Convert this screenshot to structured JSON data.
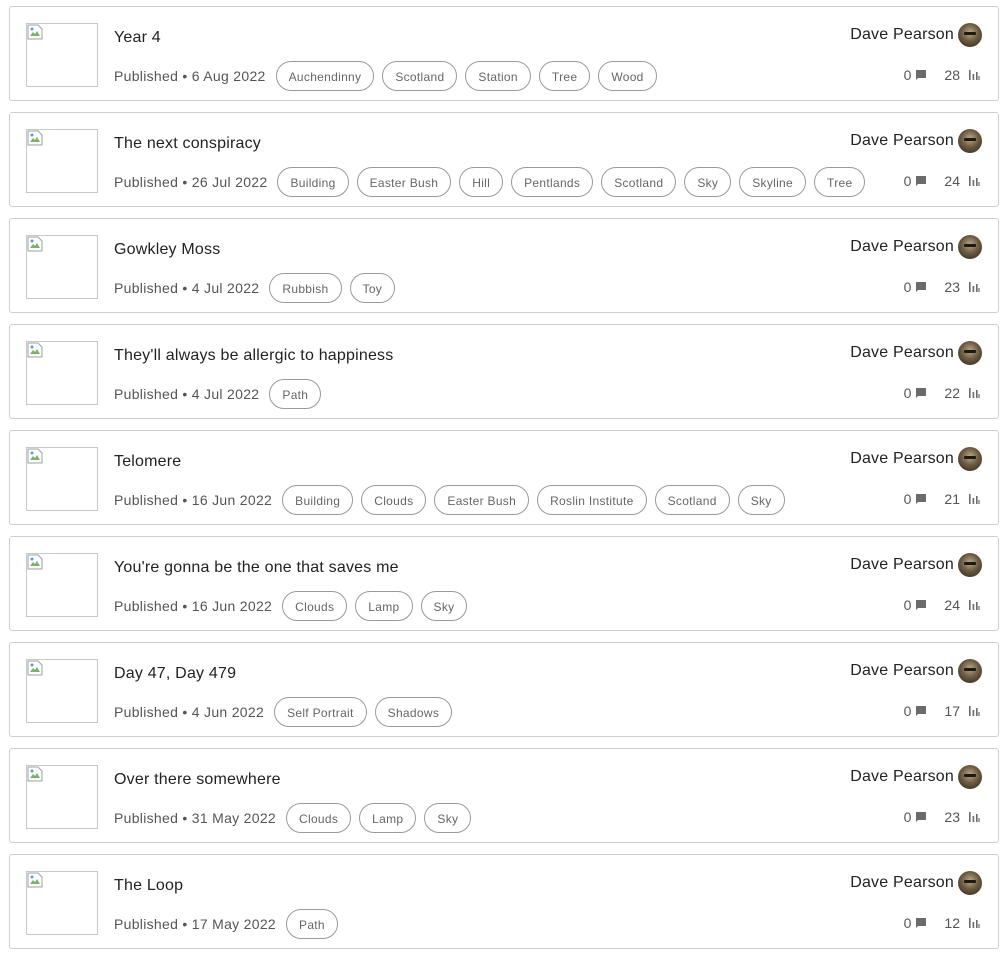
{
  "colors": {
    "border": "#cfcfcf",
    "tag_border": "#9a9a9a",
    "icon": "#6b6b6b"
  },
  "icons": {
    "comments": "comment-icon",
    "views": "bar-chart-icon"
  },
  "posts": [
    {
      "title": "Year 4",
      "published": "Published • 6 Aug 2022",
      "tags": [
        "Auchendinny",
        "Scotland",
        "Station",
        "Tree",
        "Wood"
      ],
      "author": "Dave Pearson",
      "comments": "0",
      "views": "28"
    },
    {
      "title": "The next conspiracy",
      "published": "Published • 26 Jul 2022",
      "tags": [
        "Building",
        "Easter Bush",
        "Hill",
        "Pentlands",
        "Scotland",
        "Sky",
        "Skyline",
        "Tree"
      ],
      "author": "Dave Pearson",
      "comments": "0",
      "views": "24"
    },
    {
      "title": "Gowkley Moss",
      "published": "Published • 4 Jul 2022",
      "tags": [
        "Rubbish",
        "Toy"
      ],
      "author": "Dave Pearson",
      "comments": "0",
      "views": "23"
    },
    {
      "title": "They'll always be allergic to happiness",
      "published": "Published • 4 Jul 2022",
      "tags": [
        "Path"
      ],
      "author": "Dave Pearson",
      "comments": "0",
      "views": "22"
    },
    {
      "title": "Telomere",
      "published": "Published • 16 Jun 2022",
      "tags": [
        "Building",
        "Clouds",
        "Easter Bush",
        "Roslin Institute",
        "Scotland",
        "Sky"
      ],
      "author": "Dave Pearson",
      "comments": "0",
      "views": "21"
    },
    {
      "title": "You're gonna be the one that saves me",
      "published": "Published • 16 Jun 2022",
      "tags": [
        "Clouds",
        "Lamp",
        "Sky"
      ],
      "author": "Dave Pearson",
      "comments": "0",
      "views": "24"
    },
    {
      "title": "Day 47, Day 479",
      "published": "Published • 4 Jun 2022",
      "tags": [
        "Self Portrait",
        "Shadows"
      ],
      "author": "Dave Pearson",
      "comments": "0",
      "views": "17"
    },
    {
      "title": "Over there somewhere",
      "published": "Published • 31 May 2022",
      "tags": [
        "Clouds",
        "Lamp",
        "Sky"
      ],
      "author": "Dave Pearson",
      "comments": "0",
      "views": "23"
    },
    {
      "title": "The Loop",
      "published": "Published • 17 May 2022",
      "tags": [
        "Path"
      ],
      "author": "Dave Pearson",
      "comments": "0",
      "views": "12"
    }
  ]
}
